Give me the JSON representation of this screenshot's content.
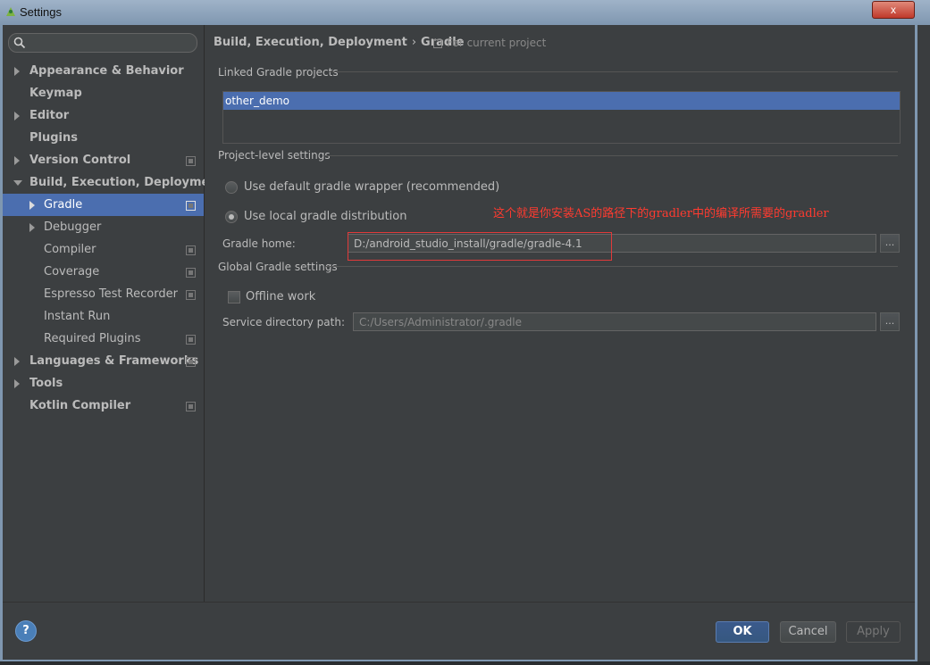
{
  "window": {
    "title": "Settings",
    "close_label": "x"
  },
  "search": {
    "placeholder": ""
  },
  "sidebar": {
    "items": [
      {
        "label": "Appearance & Behavior"
      },
      {
        "label": "Keymap"
      },
      {
        "label": "Editor"
      },
      {
        "label": "Plugins"
      },
      {
        "label": "Version Control"
      },
      {
        "label": "Build, Execution, Deployment"
      },
      {
        "label": "Gradle"
      },
      {
        "label": "Debugger"
      },
      {
        "label": "Compiler"
      },
      {
        "label": "Coverage"
      },
      {
        "label": "Espresso Test Recorder"
      },
      {
        "label": "Instant Run"
      },
      {
        "label": "Required Plugins"
      },
      {
        "label": "Languages & Frameworks"
      },
      {
        "label": "Tools"
      },
      {
        "label": "Kotlin Compiler"
      }
    ],
    "selected": "Gradle"
  },
  "breadcrumb": {
    "parent": "Build, Execution, Deployment",
    "separator": "›",
    "current": "Gradle",
    "scope": "For current project"
  },
  "linked": {
    "title": "Linked Gradle projects",
    "projects": [
      "other_demo"
    ]
  },
  "project_level": {
    "title": "Project-level settings",
    "option_wrapper": "Use default gradle wrapper (recommended)",
    "option_local": "Use local gradle distribution",
    "selected_option": "local",
    "gradle_home_label": "Gradle home:",
    "gradle_home_value": "D:/android_studio_install/gradle/gradle-4.1",
    "browse_label": "..."
  },
  "global": {
    "title": "Global Gradle settings",
    "offline_label": "Offline work",
    "offline_checked": false,
    "service_dir_label": "Service directory path:",
    "service_dir_value": "C:/Users/Administrator/.gradle",
    "browse_label": "..."
  },
  "annotation": {
    "text": "这个就是你安装AS的路径下的gradler中的编译所需要的gradler",
    "color": "#ff3b30"
  },
  "footer": {
    "help_label": "?",
    "ok_label": "OK",
    "cancel_label": "Cancel",
    "apply_label": "Apply"
  },
  "colors": {
    "selection": "#4b6eaf",
    "panel": "#3c3f41"
  }
}
